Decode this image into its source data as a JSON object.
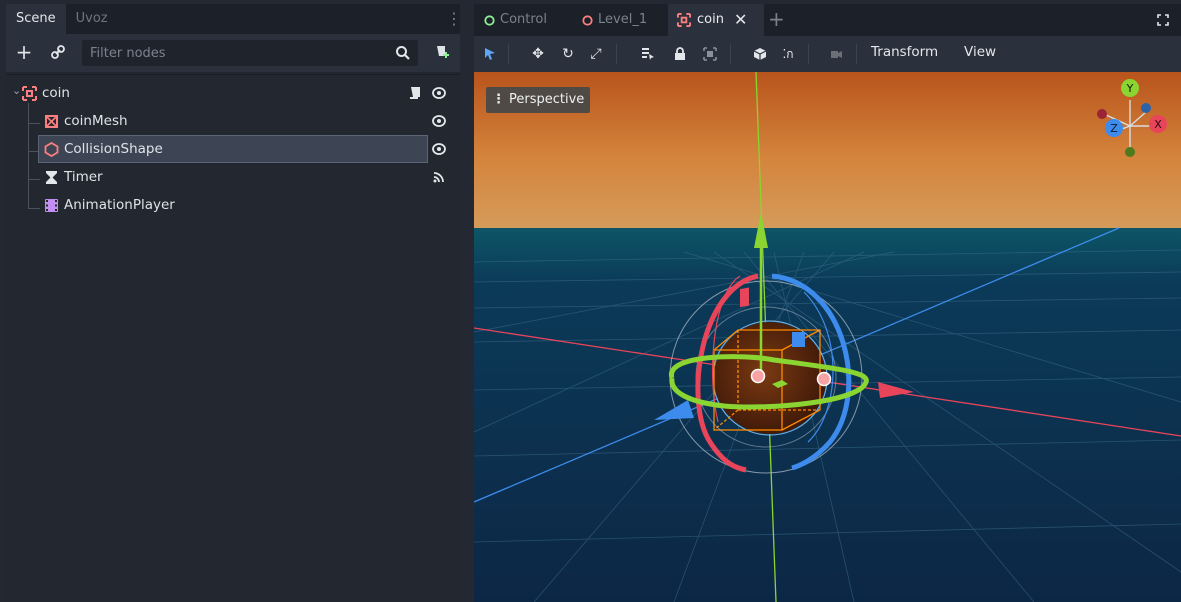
{
  "scene_dock": {
    "tabs": [
      "Scene",
      "Uvoz"
    ],
    "filter_placeholder": "Filter nodes",
    "nodes": [
      {
        "name": "coin",
        "icon": "node3d-icon"
      },
      {
        "name": "coinMesh",
        "icon": "mesh-instance-icon"
      },
      {
        "name": "CollisionShape",
        "icon": "collision-shape-icon",
        "selected": true
      },
      {
        "name": "Timer",
        "icon": "timer-icon"
      },
      {
        "name": "AnimationPlayer",
        "icon": "animation-player-icon"
      }
    ]
  },
  "scene_tabs": [
    {
      "label": "Control",
      "icon": "circle-icon",
      "color": "#8eef97"
    },
    {
      "label": "Level_1",
      "icon": "circle-icon",
      "color": "#fc7f7f"
    },
    {
      "label": "coin",
      "icon": "node3d-icon",
      "color": "#fc7f7f",
      "active": true
    }
  ],
  "viewport_menus": [
    "Transform",
    "View"
  ],
  "viewport_label": "Perspective",
  "gizmo_axes": {
    "y": "Y",
    "z": "Z",
    "x": "X"
  },
  "colors": {
    "accent_x": "#e8445a",
    "accent_y": "#8ad531",
    "accent_z": "#3d8bec",
    "sky_top": "#b5541e",
    "ground": "#0f2d48"
  }
}
